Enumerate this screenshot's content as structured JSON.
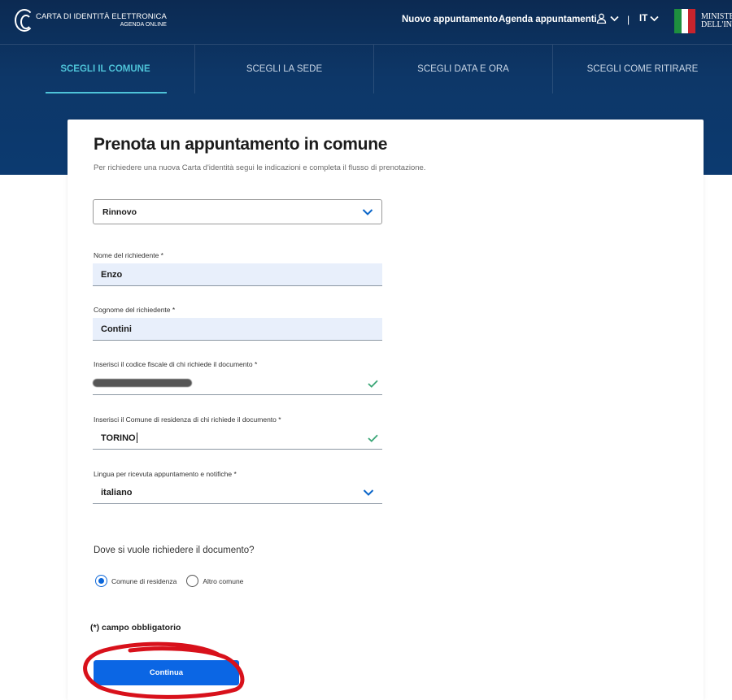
{
  "header": {
    "logo_title": "CARTA DI IDENTITÀ ELETTRONICA",
    "logo_subtitle": "AGENDA ONLINE",
    "nav": [
      "Nuovo appuntamento",
      "Agenda appuntamenti"
    ],
    "language": "IT",
    "separator": "|",
    "ministry_lines": [
      "MINISTE",
      "DELL'IN"
    ],
    "flag_colors": [
      "#1e8f3e",
      "#ffffff",
      "#c8242d"
    ]
  },
  "steps": [
    {
      "label": "SCEGLI IL COMUNE",
      "active": true
    },
    {
      "label": "SCEGLI LA SEDE",
      "active": false
    },
    {
      "label": "SCEGLI DATA E ORA",
      "active": false
    },
    {
      "label": "SCEGLI COME RITIRARE",
      "active": false
    }
  ],
  "form": {
    "title": "Prenota un appuntamento in comune",
    "subtitle": "Per richiedere una nuova Carta d'identità segui le indicazioni e completa il flusso di prenotazione.",
    "request_type": "Rinnovo",
    "first_name_label": "Nome del richiedente *",
    "first_name_value": "Enzo",
    "last_name_label": "Cognome del richiedente *",
    "last_name_value": "Contini",
    "tax_code_label": "Inserisci il codice fiscale di chi richiede il documento *",
    "municipality_label": "Inserisci il Comune di residenza di chi richiede il documento *",
    "municipality_value": "TORINO",
    "language_label": "Lingua per ricevuta appuntamento e notifiche *",
    "language_value": "italiano",
    "question": "Dove si vuole richiedere il documento?",
    "radio_options": [
      {
        "label": "Comune di residenza",
        "checked": true
      },
      {
        "label": "Altro comune",
        "checked": false
      }
    ],
    "required_note": "(*) campo obbligatorio",
    "submit_label": "Continua"
  },
  "colors": {
    "header_bg": "#0c2f5c",
    "accent": "#4ec3d8",
    "primary": "#0b66e4",
    "check": "#3aa676",
    "annotation": "#d8111b"
  },
  "icons": [
    "logo-icon",
    "user-icon",
    "chevron-down-icon",
    "check-icon",
    "ministry-emblem"
  ]
}
